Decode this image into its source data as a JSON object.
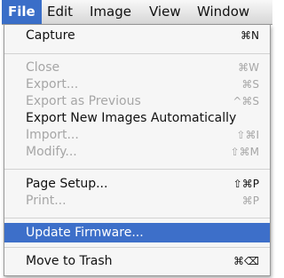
{
  "menubar": {
    "items": [
      {
        "label": "File"
      },
      {
        "label": "Edit"
      },
      {
        "label": "Image"
      },
      {
        "label": "View"
      },
      {
        "label": "Window"
      }
    ]
  },
  "menu": {
    "capture": {
      "label": "Capture",
      "shortcut": "⌘N"
    },
    "close": {
      "label": "Close",
      "shortcut": "⌘W"
    },
    "export": {
      "label": "Export...",
      "shortcut": "⌘S"
    },
    "export_previous": {
      "label": "Export as Previous",
      "shortcut": "^⌘S"
    },
    "export_new_auto": {
      "label": "Export New Images Automatically"
    },
    "import": {
      "label": "Import...",
      "shortcut": "⇧⌘I"
    },
    "modify": {
      "label": "Modify...",
      "shortcut": "⇧⌘M"
    },
    "page_setup": {
      "label": "Page Setup...",
      "shortcut": "⇧⌘P"
    },
    "print": {
      "label": "Print...",
      "shortcut": "⌘P"
    },
    "update_firmware": {
      "label": "Update Firmware..."
    },
    "move_to_trash": {
      "label": "Move to Trash",
      "shortcut": "⌘⌫"
    }
  }
}
